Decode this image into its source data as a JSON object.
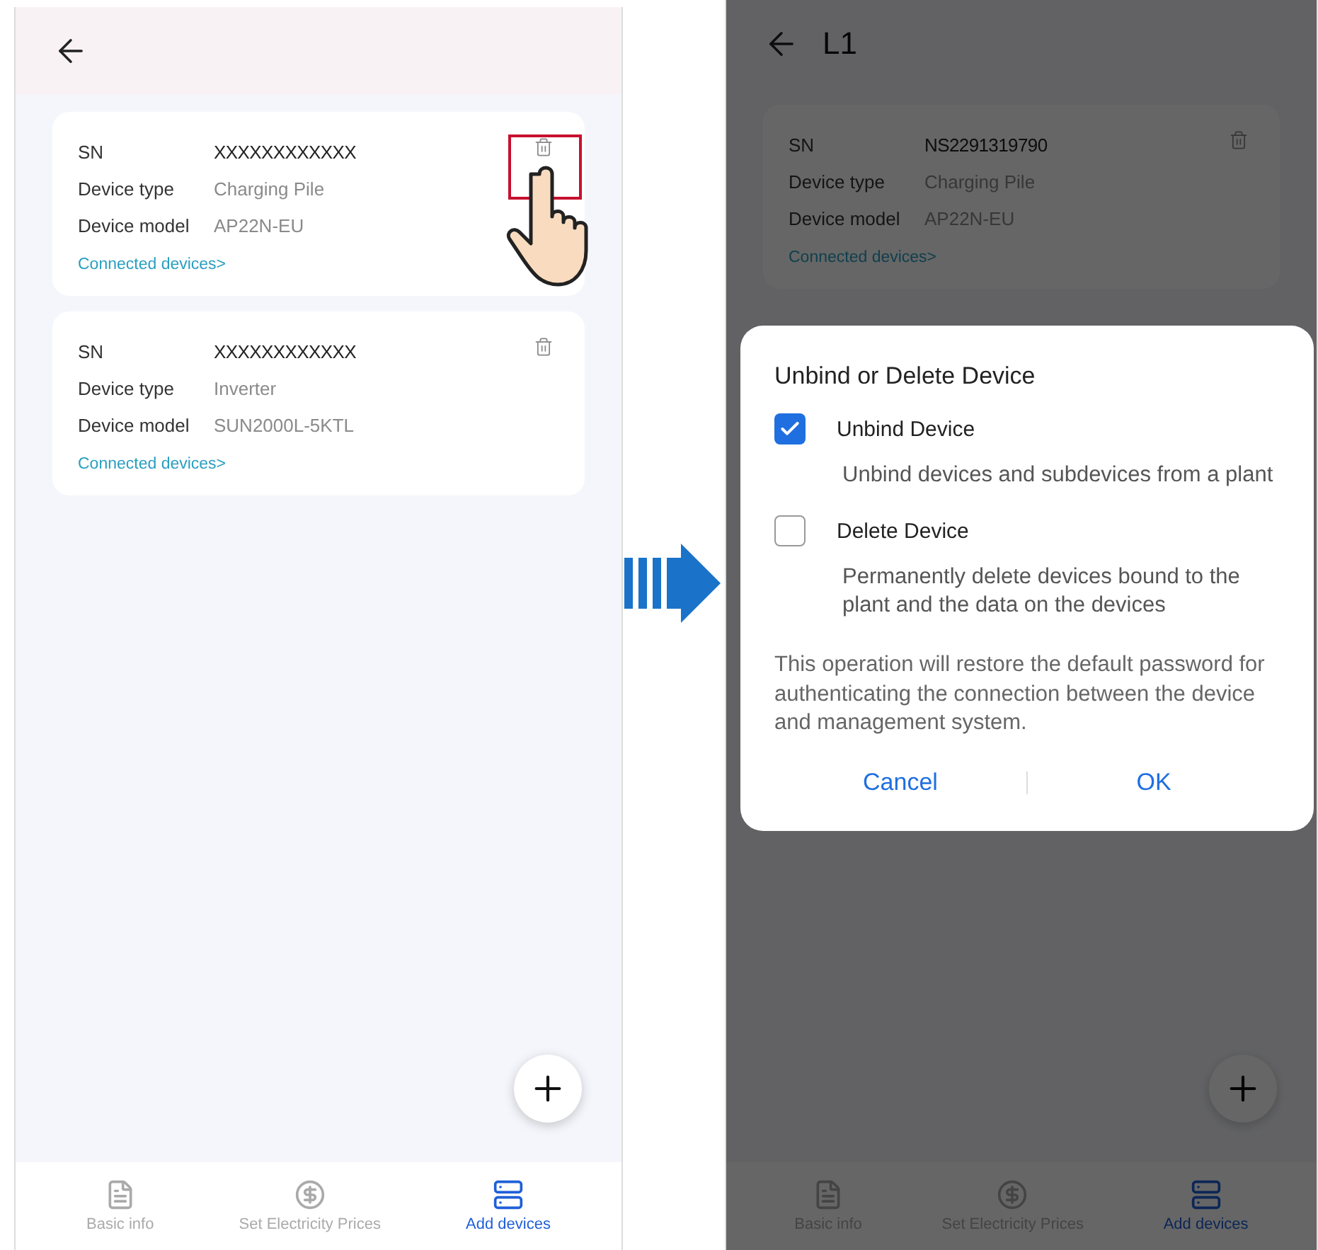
{
  "left_screen": {
    "cards": [
      {
        "fields": [
          {
            "label": "SN",
            "value": "XXXXXXXXXXXX",
            "kind": "strong"
          },
          {
            "label": "Device type",
            "value": "Charging Pile",
            "kind": "muted"
          },
          {
            "label": "Device model",
            "value": "AP22N-EU",
            "kind": "muted"
          }
        ],
        "link": "Connected devices>",
        "tap_marker": true
      },
      {
        "fields": [
          {
            "label": "SN",
            "value": "XXXXXXXXXXXX",
            "kind": "strong"
          },
          {
            "label": "Device type",
            "value": "Inverter",
            "kind": "muted"
          },
          {
            "label": "Device model",
            "value": "SUN2000L-5KTL",
            "kind": "muted"
          }
        ],
        "link": "Connected devices>",
        "tap_marker": false
      }
    ],
    "tabs": [
      {
        "label": "Basic info",
        "kind": "document",
        "selected": false
      },
      {
        "label": "Set Electricity Prices",
        "kind": "coin",
        "selected": false
      },
      {
        "label": "Add devices",
        "kind": "server",
        "selected": true
      }
    ]
  },
  "right_screen": {
    "title": "L1",
    "cards": [
      {
        "fields": [
          {
            "label": "SN",
            "value": "NS2291319790",
            "kind": "strong"
          },
          {
            "label": "Device type",
            "value": "Charging Pile",
            "kind": "muted"
          },
          {
            "label": "Device model",
            "value": "AP22N-EU",
            "kind": "muted"
          }
        ],
        "link": "Connected devices>",
        "tap_marker": false
      }
    ],
    "tabs": [
      {
        "label": "Basic info",
        "kind": "document",
        "selected": false
      },
      {
        "label": "Set Electricity Prices",
        "kind": "coin",
        "selected": false
      },
      {
        "label": "Add devices",
        "kind": "server",
        "selected": true
      }
    ],
    "dialog": {
      "title": "Unbind or Delete Device",
      "options": [
        {
          "label": "Unbind Device",
          "description": "Unbind devices and subdevices from a plant",
          "checked": true
        },
        {
          "label": "Delete Device",
          "description": "Permanently delete devices bound to the plant and the data on the devices",
          "checked": false
        }
      ],
      "note": "This operation will restore the default password for authenticating the connection between the device and management system.",
      "buttons": [
        {
          "label": "Cancel"
        },
        {
          "label": "OK"
        }
      ]
    }
  }
}
